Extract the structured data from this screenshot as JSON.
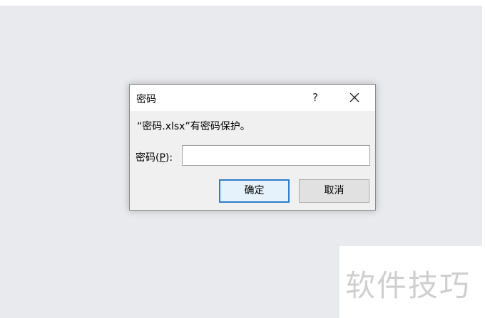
{
  "dialog": {
    "title": "密码",
    "help_label": "?",
    "message": "“密码.xlsx”有密码保护。",
    "password_label_prefix": "密码(",
    "password_label_mnemonic": "P",
    "password_label_suffix": "):",
    "password_value": "",
    "ok_label": "确定",
    "cancel_label": "取消"
  },
  "watermark": {
    "text": "软件技巧"
  },
  "colors": {
    "desktop_bg": "#e9eaed",
    "dialog_bg": "#f0f0f0",
    "default_button_border": "#2c7fc9"
  }
}
